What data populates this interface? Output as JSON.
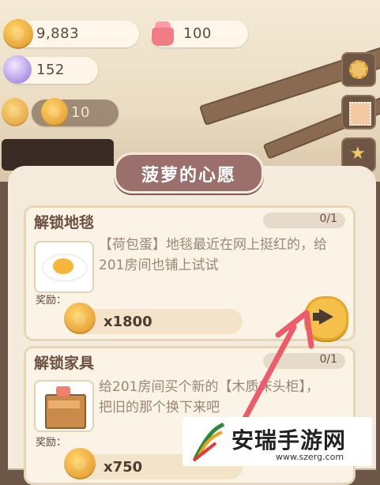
{
  "resources": {
    "coins": "9,883",
    "cake": "100",
    "gems": "152",
    "tokens": "10"
  },
  "dialog": {
    "title": "菠萝的心愿"
  },
  "quests": [
    {
      "title": "解锁地毯",
      "progress": "0/1",
      "desc_line1": "【荷包蛋】地毯最近在网上挺红的，给",
      "desc_line2": "201房间也铺上试试",
      "reward_label": "奖励：",
      "reward_amount": "x1800",
      "thumb_icon": "fried-egg-rug-icon"
    },
    {
      "title": "解锁家具",
      "progress": "0/1",
      "desc_line1": "给201房间买个新的【木质床头柜】，",
      "desc_line2": "把旧的那个换下来吧",
      "reward_label": "奖励：",
      "reward_amount": "x750",
      "thumb_icon": "wooden-nightstand-icon"
    }
  ],
  "watermark": {
    "name": "安瑞手游网",
    "url": "www.szerg.com"
  },
  "colors": {
    "accent": "#f5c04a",
    "title_plate": "#9a6f6c",
    "panel": "#f5ebdc",
    "annotation_arrow": "#ee5b6b"
  }
}
